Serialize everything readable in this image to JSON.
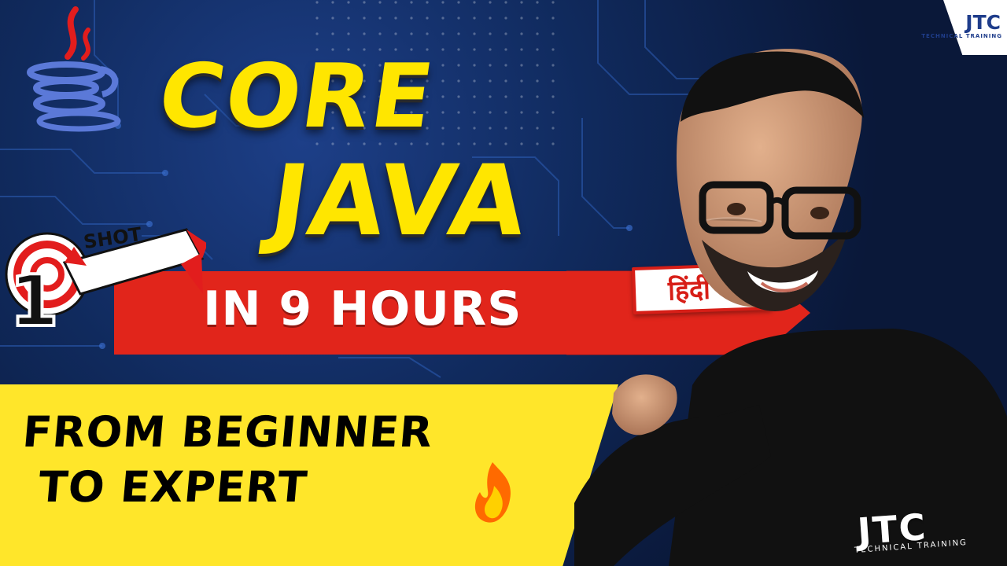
{
  "title": {
    "line1": "CORE",
    "line2": "JAVA"
  },
  "badge": {
    "hours": "IN 9 HOURS",
    "language": "हिंदी में",
    "shot_number": "1",
    "shot_label": "SHOT"
  },
  "subtitle": {
    "line1": "FROM BEGINNER",
    "line2": "TO EXPERT"
  },
  "brand": {
    "corner_logo": "JTC",
    "corner_tagline": "TECHNICAL TRAINING",
    "shirt_logo": "JTC",
    "shirt_tagline": "TECHNICAL TRAINING"
  },
  "colors": {
    "title_yellow": "#ffe600",
    "banner_red": "#e1251b",
    "banner_yellow": "#ffe62a",
    "background_blue": "#0b1a3c"
  },
  "icons": [
    "java-logo-icon",
    "fire-icon",
    "one-shot-arrow-icon"
  ]
}
